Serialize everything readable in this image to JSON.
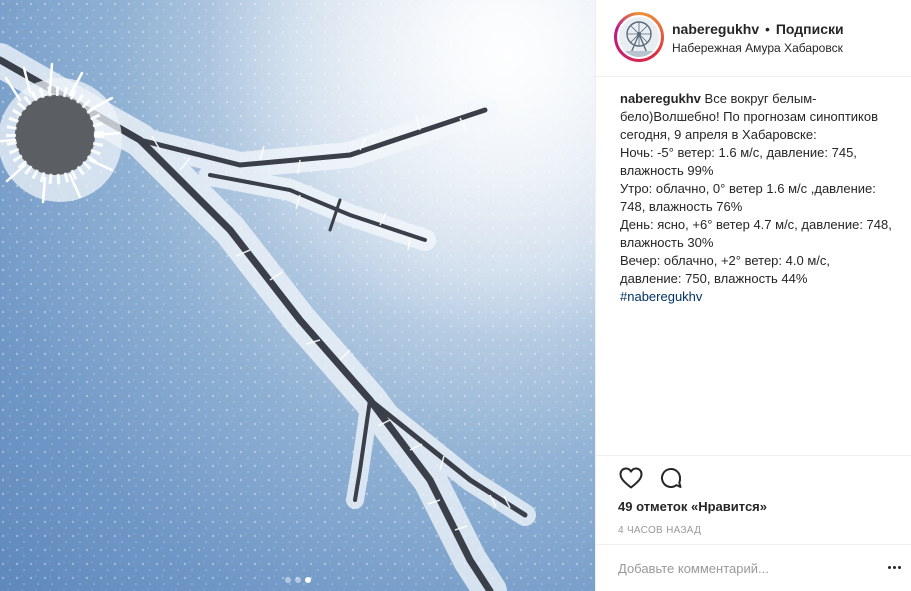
{
  "post": {
    "username": "naberegukhv",
    "separator": "•",
    "follow_label": "Подписки",
    "location": "Набережная Амура Хабаровск",
    "caption": {
      "user": "naberegukhv",
      "lines": [
        "Все вокруг белым-",
        "бело)Волшебно! По прогнозам синоптиков",
        "сегодня, 9 апреля в Хабаровске:",
        "Ночь: -5° ветер: 1.6 м/с, давление: 745,",
        "влажность 99%",
        "Утро: облачно, 0° ветер 1.6 м/с ,давление:",
        "748, влажность 76%",
        "День: ясно, +6° ветер 4.7 м/с, давление: 748,",
        "влажность 30%",
        "Вечер: облачно, +2° ветер: 4.0 м/с,",
        "давление: 750, влажность 44%"
      ],
      "hashtag": "#naberegukhv"
    },
    "likes": "49 отметок «Нравится»",
    "time": "4 часов назад",
    "comment_placeholder": "Добавьте комментарий...",
    "carousel": {
      "count": 3,
      "active_index": 2
    }
  },
  "icons": {
    "like": "heart-icon",
    "comment": "comment-icon",
    "more": "more-options-icon",
    "avatar": "ferris-wheel-logo"
  }
}
